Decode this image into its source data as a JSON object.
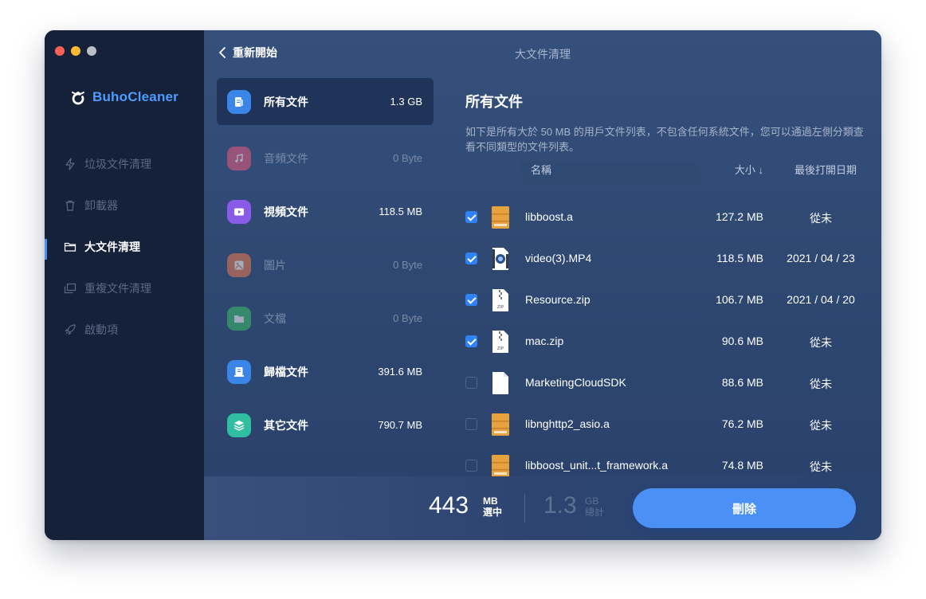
{
  "app": {
    "logo_text": "BuhoCleaner",
    "window_title": "大文件清理",
    "back_label": "重新開始",
    "accent_color": "#4a90f5"
  },
  "sidebar": {
    "items": [
      {
        "label": "垃圾文件清理",
        "icon": "lightning-icon",
        "active": false
      },
      {
        "label": "卸載器",
        "icon": "trash-icon",
        "active": false
      },
      {
        "label": "大文件清理",
        "icon": "folder-icon",
        "active": true
      },
      {
        "label": "重複文件清理",
        "icon": "duplicate-icon",
        "active": false
      },
      {
        "label": "啟動項",
        "icon": "rocket-icon",
        "active": false
      }
    ]
  },
  "categories": [
    {
      "label": "所有文件",
      "size": "1.3 GB",
      "icon": "all-files-icon",
      "color": "#3a86e8",
      "active": true
    },
    {
      "label": "音頻文件",
      "size": "0 Byte",
      "icon": "music-icon",
      "color": "#ef5a7a",
      "dim": true
    },
    {
      "label": "視頻文件",
      "size": "118.5 MB",
      "icon": "video-icon",
      "color": "#8a5ae8"
    },
    {
      "label": "圖片",
      "size": "0 Byte",
      "icon": "image-icon",
      "color": "#f07a4e",
      "dim": true
    },
    {
      "label": "文檔",
      "size": "0 Byte",
      "icon": "document-icon",
      "color": "#3fbf6a",
      "dim": true
    },
    {
      "label": "歸檔文件",
      "size": "391.6 MB",
      "icon": "archive-icon",
      "color": "#3a86e8"
    },
    {
      "label": "其它文件",
      "size": "790.7 MB",
      "icon": "layers-icon",
      "color": "#2fbfa0"
    }
  ],
  "panel": {
    "title": "所有文件",
    "description": "如下是所有大於 50 MB 的用戶文件列表，不包含任何系統文件，您可以通過左側分類查看不同類型的文件列表。",
    "columns": {
      "name": "名稱",
      "size": "大小 ↓",
      "date": "最後打開日期"
    }
  },
  "files": [
    {
      "name": "libboost.a",
      "size": "127.2 MB",
      "date": "從未",
      "checked": true,
      "icon": "library-file-icon"
    },
    {
      "name": "video(3).MP4",
      "size": "118.5 MB",
      "date": "2021 / 04 / 23",
      "checked": true,
      "icon": "video-file-icon"
    },
    {
      "name": "Resource.zip",
      "size": "106.7 MB",
      "date": "2021 / 04 / 20",
      "checked": true,
      "icon": "zip-file-icon"
    },
    {
      "name": "mac.zip",
      "size": "90.6 MB",
      "date": "從未",
      "checked": true,
      "icon": "zip-file-icon"
    },
    {
      "name": "MarketingCloudSDK",
      "size": "88.6 MB",
      "date": "從未",
      "checked": false,
      "icon": "blank-file-icon"
    },
    {
      "name": "libnghttp2_asio.a",
      "size": "76.2 MB",
      "date": "從未",
      "checked": false,
      "icon": "library-file-icon"
    },
    {
      "name": "libboost_unit...t_framework.a",
      "size": "74.8 MB",
      "date": "從未",
      "checked": false,
      "icon": "library-file-icon"
    }
  ],
  "footer": {
    "selected_value": "443",
    "selected_unit": "MB",
    "selected_label": "選中",
    "total_value": "1.3",
    "total_unit": "GB",
    "total_label": "總計",
    "delete_label": "刪除"
  }
}
